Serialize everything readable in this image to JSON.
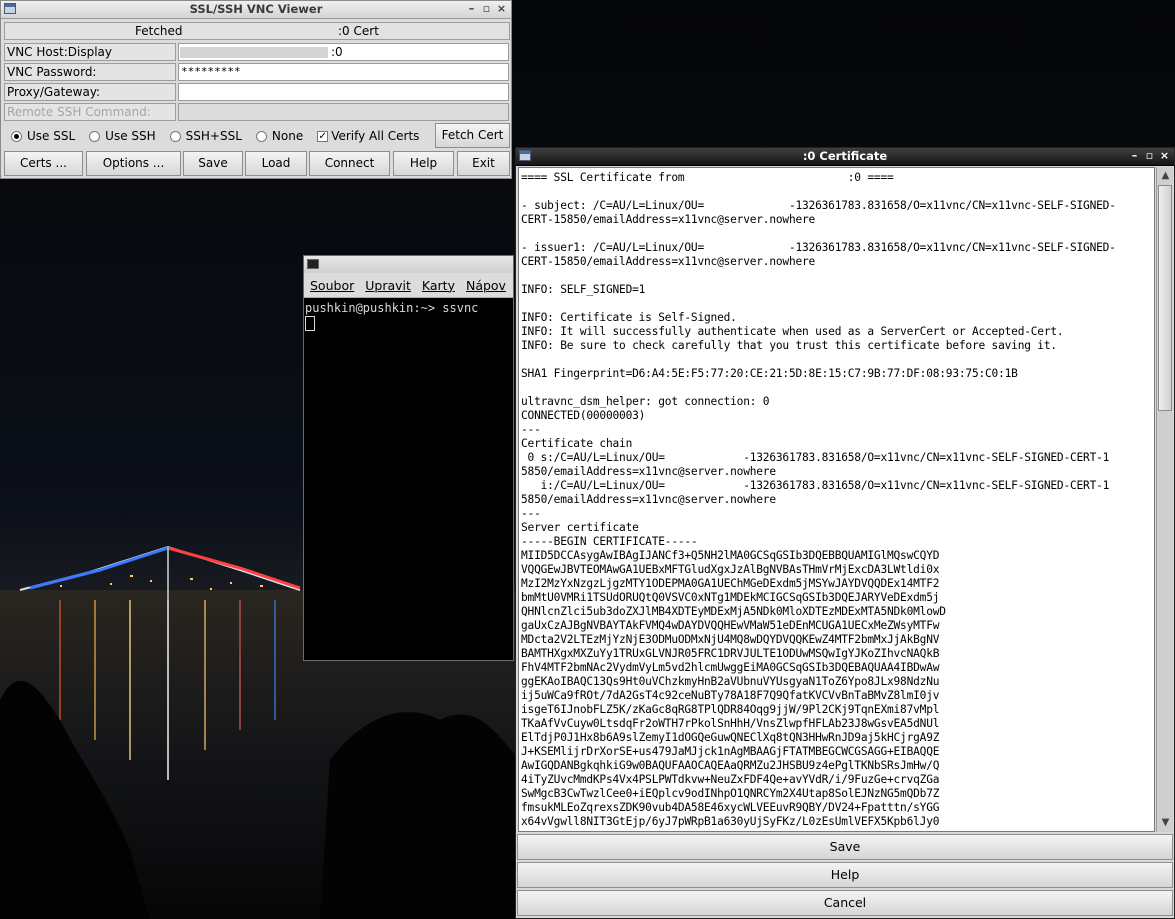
{
  "vnc_viewer": {
    "title": "SSL/SSH VNC Viewer",
    "fetched_label": "Fetched",
    "fetched_value": ":0 Cert",
    "host_label": "VNC Host:Display",
    "host_display": ":0",
    "password_label": "VNC Password:",
    "password_value": "*********",
    "proxy_label": "Proxy/Gateway:",
    "proxy_value": "",
    "remote_ssh_label": "Remote SSH Command:",
    "radios": [
      {
        "label": "Use SSL",
        "selected": true
      },
      {
        "label": "Use SSH",
        "selected": false
      },
      {
        "label": "SSH+SSL",
        "selected": false
      },
      {
        "label": "None",
        "selected": false
      }
    ],
    "verify_label": "Verify All Certs",
    "verify_checked": true,
    "fetch_cert_label": "Fetch Cert",
    "buttons": {
      "certs": "Certs ...",
      "options": "Options ...",
      "save": "Save",
      "load": "Load",
      "connect": "Connect",
      "help": "Help",
      "exit": "Exit"
    },
    "window_controls": {
      "minimize": "–",
      "maximize": "▫",
      "close": "×"
    }
  },
  "terminal": {
    "menu": [
      "Soubor",
      "Upravit",
      "Karty",
      "Nápov"
    ],
    "prompt_line": "pushkin@pushkin:~> ssvnc"
  },
  "certificate_window": {
    "title": ":0 Certificate",
    "lines": [
      "==== SSL Certificate from                         :0 ====",
      "",
      "- subject: /C=AU/L=Linux/OU=             -1326361783.831658/O=x11vnc/CN=x11vnc-SELF-SIGNED-",
      "CERT-15850/emailAddress=x11vnc@server.nowhere",
      "",
      "- issuer1: /C=AU/L=Linux/OU=             -1326361783.831658/O=x11vnc/CN=x11vnc-SELF-SIGNED-",
      "CERT-15850/emailAddress=x11vnc@server.nowhere",
      "",
      "INFO: SELF_SIGNED=1",
      "",
      "INFO: Certificate is Self-Signed.",
      "INFO: It will successfully authenticate when used as a ServerCert or Accepted-Cert.",
      "INFO: Be sure to check carefully that you trust this certificate before saving it.",
      "",
      "SHA1 Fingerprint=D6:A4:5E:F5:77:20:CE:21:5D:8E:15:C7:9B:77:DF:08:93:75:C0:1B",
      "",
      "ultravnc_dsm_helper: got connection: 0",
      "CONNECTED(00000003)",
      "---",
      "Certificate chain",
      " 0 s:/C=AU/L=Linux/OU=            -1326361783.831658/O=x11vnc/CN=x11vnc-SELF-SIGNED-CERT-1",
      "5850/emailAddress=x11vnc@server.nowhere",
      "   i:/C=AU/L=Linux/OU=            -1326361783.831658/O=x11vnc/CN=x11vnc-SELF-SIGNED-CERT-1",
      "5850/emailAddress=x11vnc@server.nowhere",
      "---",
      "Server certificate",
      "-----BEGIN CERTIFICATE-----",
      "MIID5DCCAsygAwIBAgIJANCf3+Q5NH2lMA0GCSqGSIb3DQEBBQUAMIGlMQswCQYD",
      "VQQGEwJBVTEOMAwGA1UEBxMFTGludXgxJzAlBgNVBAsTHmVrMjExcDA3LWtldi0x",
      "MzI2MzYxNzgzLjgzMTY1ODEPMA0GA1UEChMGeDExdm5jMSYwJAYDVQQDEx14MTF2",
      "bmMtU0VMRi1TSUdORUQtQ0VSVC0xNTg1MDEkMCIGCSqGSIb3DQEJARYVeDExdm5j",
      "QHNlcnZlci5ub3doZXJlMB4XDTEyMDExMjA5NDk0MloXDTEzMDExMTA5NDk0MlowD",
      "gaUxCzAJBgNVBAYTAkFVMQ4wDAYDVQQHEwVMaW51eDEnMCUGA1UECxMeZWsyMTFw",
      "MDcta2V2LTEzMjYzNjE3ODMuODMxNjU4MQ8wDQYDVQQKEwZ4MTF2bmMxJjAkBgNV",
      "BAMTHXgxMXZuYy1TRUxGLVNJR05FRC1DRVJULTE1ODUwMSQwIgYJKoZIhvcNAQkB",
      "FhV4MTF2bmNAc2VydmVyLm5vd2hlcmUwggEiMA0GCSqGSIb3DQEBAQUAA4IBDwAw",
      "ggEKAoIBAQC13Qs9Ht0uVChzkmyHnB2aVUbnuVYUsgyaN1ToZ6Ypo8JLx98NdzNu",
      "ij5uWCa9fROt/7dA2GsT4c92ceNuBTy78A18F7Q9QfatKVCVvBnTaBMvZ8lmI0jv",
      "isgeT6IJnobFLZ5K/zKaGc8qRG8TPlQDR84Oqg9jjW/9Pl2CKj9TqnEXmi87vMpl",
      "TKaAfVvCuyw0LtsdqFr2oWTH7rPkolSnHhH/VnsZlwpfHFLAb23J8wGsvEA5dNUl",
      "ElTdjP0J1Hx8b6A9slZemyI1dOGQeGuwQNEClXq8tQN3HHwRnJD9aj5kHCjrgA9Z",
      "J+KSEMlijrDrXorSE+us479JaMJjck1nAgMBAAGjFTATMBEGCWCGSAGG+EIBAQQE",
      "AwIGQDANBgkqhkiG9w0BAQUFAAOCAQEAaQRMZu2JHSBU9z4ePglTKNbSRsJmHw/Q",
      "4iTyZUvcMmdKPs4Vx4PSLPWTdkvw+NeuZxFDF4Qe+avYVdR/i/9FuzGe+crvqZGa",
      "SwMgcB3CwTwzlCee0+iEQplcv9odINhpO1QNRCYm2X4Utap8SolEJNzNG5mQDb7Z",
      "fmsukMLEoZqrexsZDK90vub4DA58E46xycWLVEEuvR9QBY/DV24+Fpatttn/sYGG",
      "x64vVgwll8NIT3GtEjp/6yJ7pWRpB1a630yUjSyFKz/L0zEsUmlVEFX5Kpb6lJy0"
    ],
    "buttons": {
      "save": "Save",
      "help": "Help",
      "cancel": "Cancel"
    },
    "scroll_up": "▲",
    "scroll_down": "▼"
  }
}
